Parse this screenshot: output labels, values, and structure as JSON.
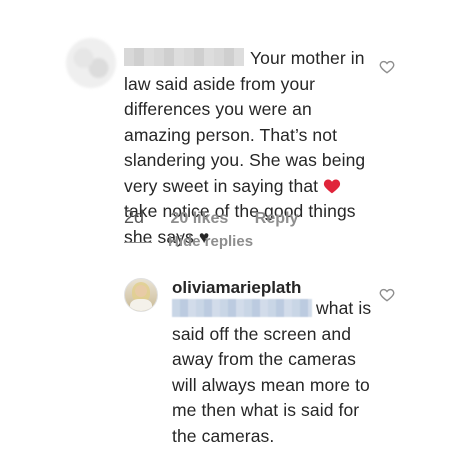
{
  "comments": [
    {
      "text_line1": "Your mother in",
      "text_rest": "law said aside from your differences you were an amazing person. That’s not slandering you. She was being very sweet in saying that",
      "text_after_emoji": "take notice of the good things she says ♥",
      "age": "2d",
      "likes": "20 likes",
      "reply": "Reply",
      "hide_replies": "Hide replies"
    },
    {
      "username": "oliviamarieplath",
      "text_after_mention": "what is said off the screen and away from the cameras will always mean more to me then what is said for the cameras."
    }
  ],
  "icons": {
    "like": "heart-outline-icon",
    "emoji": "red-heart-emoji"
  },
  "colors": {
    "text": "#262626",
    "meta": "#8e8e8e",
    "emoji_heart": "#e0243a"
  }
}
